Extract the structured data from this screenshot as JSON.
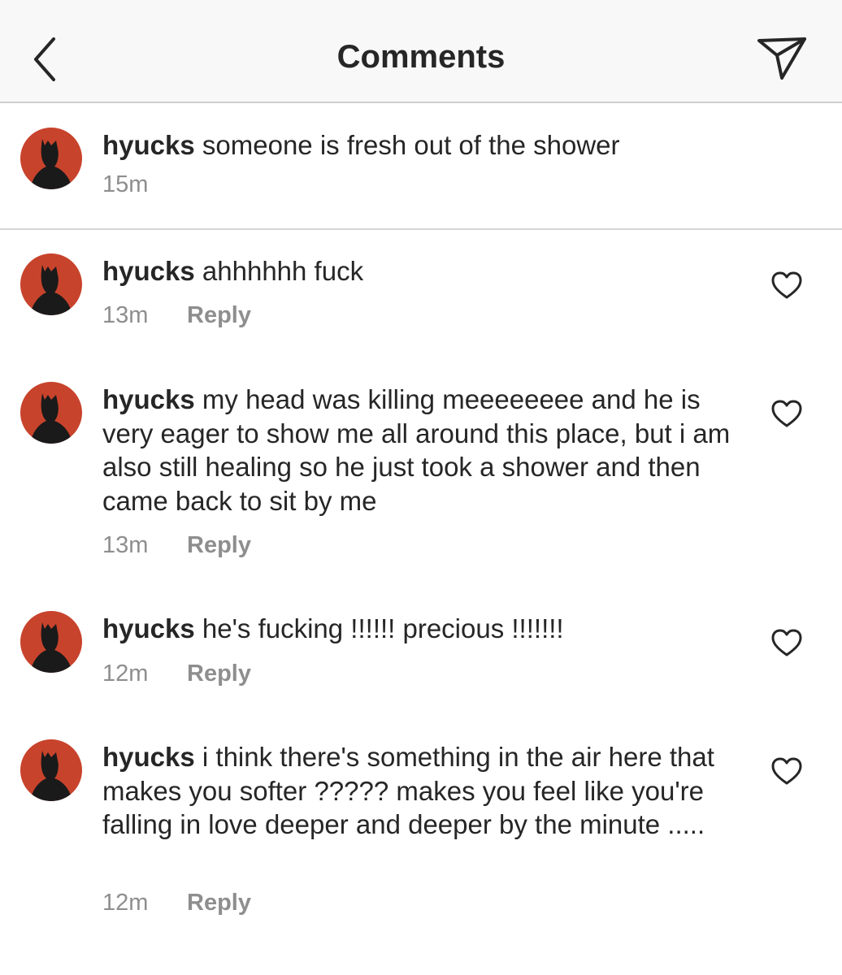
{
  "header": {
    "title": "Comments"
  },
  "caption": {
    "username": "hyucks",
    "text": "someone is fresh out of the shower",
    "time": "15m"
  },
  "comments": [
    {
      "username": "hyucks",
      "text": "ahhhhhh fuck",
      "time": "13m",
      "reply_label": "Reply"
    },
    {
      "username": "hyucks",
      "text": "my head was killing meeeeeeee and he is very eager to show me all around this place, but i am also still healing so he just took a shower and then came back to sit by me",
      "time": "13m",
      "reply_label": "Reply"
    },
    {
      "username": "hyucks",
      "text": "he's fucking !!!!!! precious !!!!!!!",
      "time": "12m",
      "reply_label": "Reply"
    },
    {
      "username": "hyucks",
      "text": "i think there's something in the air here that makes you softer ????? makes you feel like you're falling in love deeper and deeper by the minute .....",
      "time": "12m",
      "reply_label": "Reply"
    }
  ],
  "colors": {
    "header_bg": "#f8f8f8",
    "avatar_bg": "#c8432c",
    "text": "#262626",
    "muted": "#8e8e8e"
  },
  "icons": {
    "back": "chevron-left-icon",
    "send": "paper-plane-icon",
    "like": "heart-outline-icon"
  }
}
